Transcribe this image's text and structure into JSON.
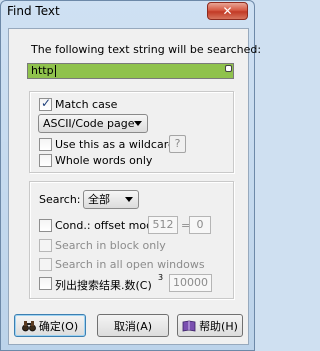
{
  "window": {
    "title": "Find Text",
    "close_glyph": "✕"
  },
  "search": {
    "prompt": "The following text string will be searched:",
    "value": "http"
  },
  "options": {
    "match_case": {
      "label": "Match case",
      "checked": true
    },
    "encoding": {
      "selected": "ASCII/Code page"
    },
    "wildcard": {
      "label": "Use this as a wildcard:",
      "checked": false,
      "button": "?"
    },
    "whole_words": {
      "label": "Whole words only",
      "checked": false
    }
  },
  "scope": {
    "search_label": "Search:",
    "search_selected": "全部",
    "cond": {
      "label": "Cond.: offset mod",
      "modulus": "512",
      "equals": "=",
      "remainder": "0"
    },
    "block_only": {
      "label": "Search in block only"
    },
    "all_windows": {
      "label": "Search in all open windows"
    },
    "list_results": {
      "label": "列出搜索结果.数(C)",
      "superscript": "3",
      "count": "10000"
    }
  },
  "buttons": {
    "ok": "确定(O)",
    "cancel": "取消(A)",
    "help": "帮助(H)"
  },
  "colors": {
    "input_highlight": "#8fc24c",
    "titlebar": "#cfe1f3",
    "close": "#c23a26"
  }
}
